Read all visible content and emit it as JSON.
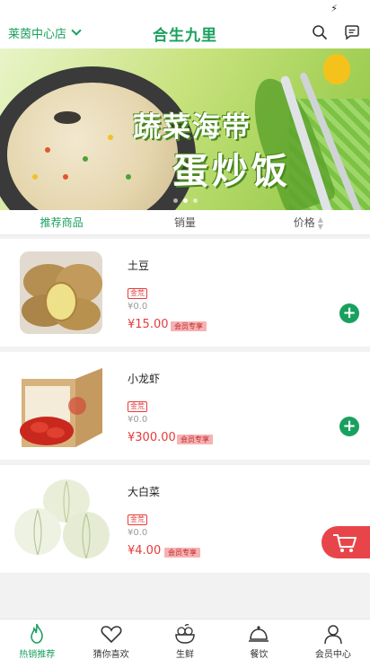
{
  "header": {
    "store_name": "莱茵中心店",
    "brand": "合生九里",
    "icons": [
      "chevron-down-icon",
      "search-icon",
      "chat-icon"
    ]
  },
  "banner": {
    "line1": "蔬菜海带",
    "line2": "蛋炒饭",
    "slides": 3,
    "active_slide": 2
  },
  "sort": {
    "items": [
      "推荐商品",
      "销量",
      "价格"
    ],
    "active": "推荐商品"
  },
  "products": [
    {
      "name": "土豆",
      "tag": "金荒",
      "old_price": "¥0.0",
      "price": "¥15.00",
      "vip": "会员专享"
    },
    {
      "name": "小龙虾",
      "tag": "金荒",
      "old_price": "¥0.0",
      "price": "¥300.00",
      "vip": "会员专享"
    },
    {
      "name": "大白菜",
      "tag": "金荒",
      "old_price": "¥0.0",
      "price": "¥4.00",
      "vip": "会员专享"
    }
  ],
  "tabs": [
    {
      "label": "热销推荐",
      "icon": "flame-icon",
      "active": true
    },
    {
      "label": "猜你喜欢",
      "icon": "heart-icon",
      "active": false
    },
    {
      "label": "生鲜",
      "icon": "produce-icon",
      "active": false
    },
    {
      "label": "餐饮",
      "icon": "cloche-icon",
      "active": false
    },
    {
      "label": "会员中心",
      "icon": "user-icon",
      "active": false
    }
  ],
  "colors": {
    "accent": "#1aa05e",
    "price": "#e53b3b",
    "cart": "#e8454a"
  }
}
